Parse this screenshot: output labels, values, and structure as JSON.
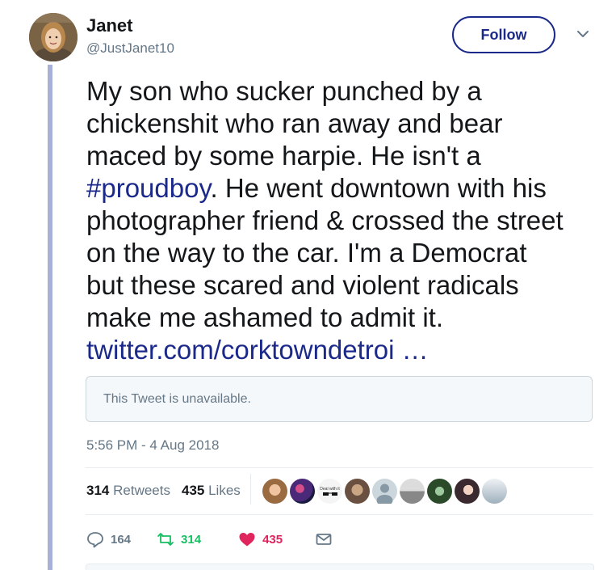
{
  "author": {
    "name": "Janet",
    "handle": "@JustJanet10"
  },
  "follow_label": "Follow",
  "tweet": {
    "lines": [
      "My son who sucker punched by a",
      "chickenshit who ran away and bear",
      "maced by some harpie. He isn't a",
      "",
      "photographer friend & crossed the street",
      "on the way to the car. I'm a Democrat",
      "but these scared and violent radicals",
      "make me ashamed to admit it."
    ],
    "hashtag": "#proudboy",
    "line4_rest": ". He went downtown with his",
    "link": "twitter.com/corktowndetroi …"
  },
  "quote_unavailable": "This Tweet is unavailable.",
  "timestamp": "5:56 PM - 4 Aug 2018",
  "stats": {
    "retweets_count": "314",
    "retweets_label": "Retweets",
    "likes_count": "435",
    "likes_label": "Likes"
  },
  "likers_overflow_text": "Deal with it",
  "actions": {
    "replies": "164",
    "retweets": "314",
    "likes": "435"
  },
  "colors": {
    "link": "#1b2a8a",
    "retweet": "#17bf63",
    "like": "#e0245e",
    "thread_line": "#a8b0d8"
  }
}
